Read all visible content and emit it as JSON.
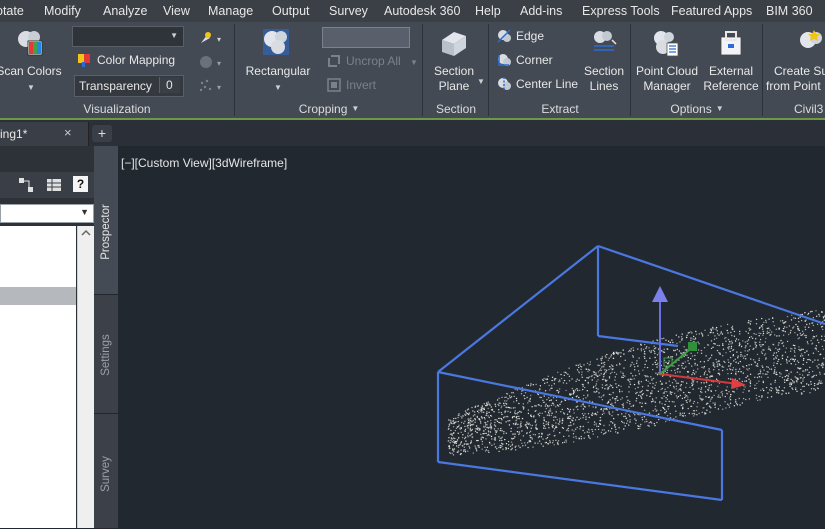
{
  "menu": [
    "otate",
    "Modify",
    "Analyze",
    "View",
    "Manage",
    "Output",
    "Survey",
    "Autodesk 360",
    "Help",
    "Add-ins",
    "Express Tools",
    "Featured Apps",
    "BIM 360"
  ],
  "ribbon": {
    "visualization": {
      "title": "Visualization",
      "scan_colors": "Scan Colors",
      "color_mapping": "Color Mapping",
      "transparency_label": "Transparency",
      "transparency_value": "0",
      "combo_value": ""
    },
    "cropping": {
      "title": "Cropping",
      "rectangular": "Rectangular",
      "uncrop_all": "Uncrop All",
      "invert": "Invert"
    },
    "section": {
      "title": "Section",
      "section_plane_line1": "Section",
      "section_plane_line2": "Plane"
    },
    "extract": {
      "title": "Extract",
      "edge": "Edge",
      "corner": "Corner",
      "center_line": "Center Line",
      "section_lines_line1": "Section",
      "section_lines_line2": "Lines"
    },
    "options": {
      "title": "Options",
      "pcm_line1": "Point Cloud",
      "pcm_line2": "Manager",
      "ext_line1": "External",
      "ext_line2": "Reference"
    },
    "civil3d": {
      "title": "Civil3",
      "create_line1": "Create Su",
      "create_line2": "from Point"
    }
  },
  "tabs": {
    "doc_tab": "ing1*",
    "close_glyph": "×",
    "add_glyph": "+"
  },
  "palette": {
    "help_glyph": "?",
    "vertical_tabs": [
      "Prospector",
      "Settings",
      "Survey"
    ]
  },
  "viewport": {
    "label": "[−][Custom View][3dWireframe]"
  },
  "colors": {
    "accent_green": "#6e9a48",
    "bbox_blue": "#4a78e0",
    "viewport_bg": "#212830",
    "ribbon_bg": "#444a53"
  }
}
